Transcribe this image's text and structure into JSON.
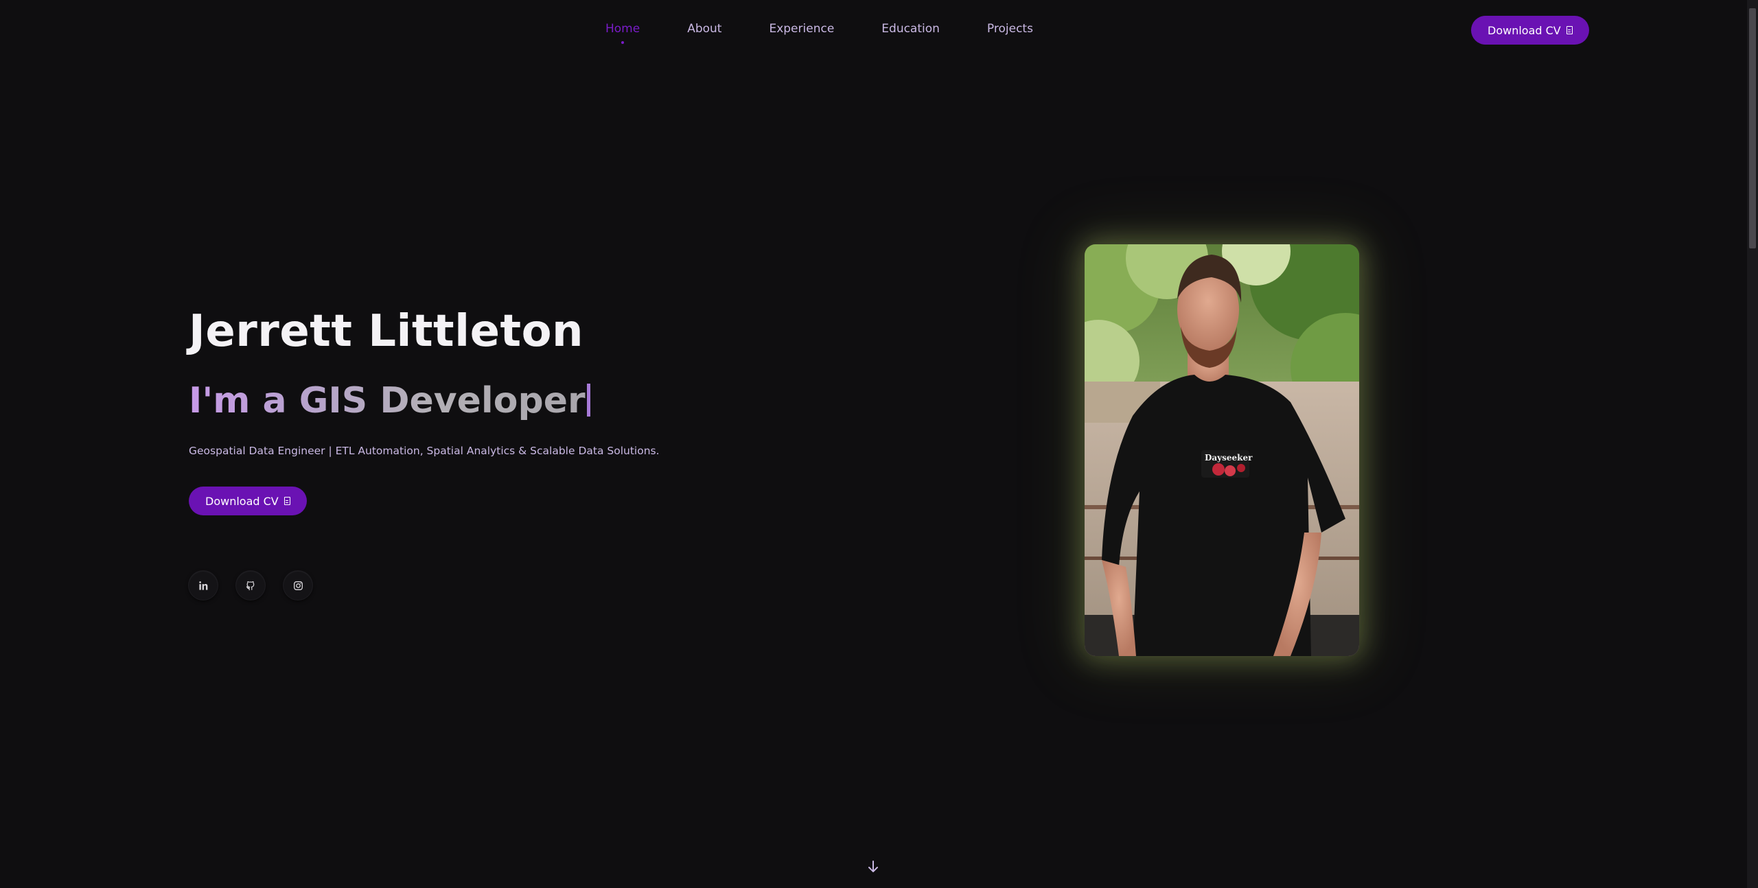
{
  "nav": {
    "links": [
      {
        "label": "Home",
        "active": true
      },
      {
        "label": "About",
        "active": false
      },
      {
        "label": "Experience",
        "active": false
      },
      {
        "label": "Education",
        "active": false
      },
      {
        "label": "Projects",
        "active": false
      }
    ],
    "cta_label": "Download CV"
  },
  "hero": {
    "name": "Jerrett Littleton",
    "role_prefix": "I'm a ",
    "role_value": "GIS Developer",
    "tagline": "Geospatial Data Engineer | ETL Automation, Spatial Analytics & Scalable Data Solutions.",
    "cta_label": "Download CV",
    "socials": [
      {
        "name": "linkedin",
        "icon": "linkedin-icon"
      },
      {
        "name": "github",
        "icon": "github-icon"
      },
      {
        "name": "instagram",
        "icon": "instagram-icon"
      }
    ],
    "portrait_tshirt_text": "Dayseeker"
  },
  "colors": {
    "background": "#0f0e10",
    "accent": "#6a12b3",
    "nav_active": "#7a1cc9",
    "nav_text": "#c9b8e3",
    "portrait_glow": "#cde678"
  },
  "icons": {
    "cta_icon": "document-icon",
    "scroll_icon": "arrow-down-icon"
  }
}
